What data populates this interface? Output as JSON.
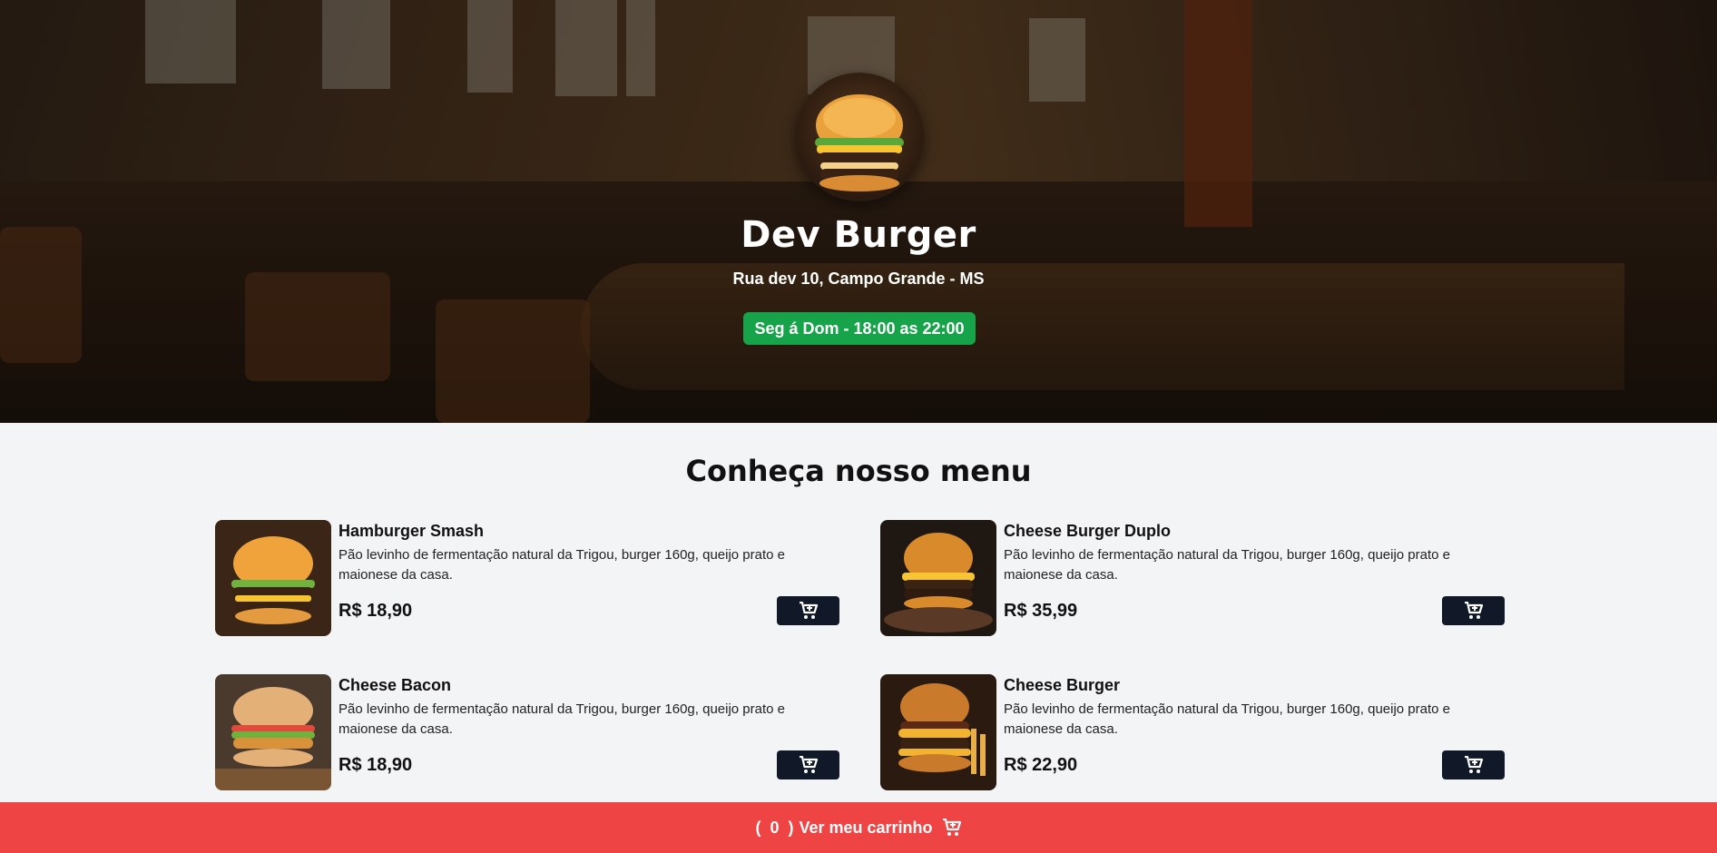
{
  "header": {
    "store_name": "Dev Burger",
    "address": "Rua dev 10, Campo Grande - MS",
    "hours": "Seg á Dom - 18:00 as 22:00",
    "hours_color": "#16a34a"
  },
  "menu": {
    "title": "Conheça nosso menu",
    "items": [
      {
        "name": "Hamburger Smash",
        "description": "Pão levinho de fermentação natural da Trigou, burger 160g, queijo prato e maionese da casa.",
        "price": "R$ 18,90",
        "icon": "cart-plus-icon"
      },
      {
        "name": "Cheese Burger Duplo",
        "description": "Pão levinho de fermentação natural da Trigou, burger 160g, queijo prato e maionese da casa.",
        "price": "R$ 35,99",
        "icon": "cart-plus-icon"
      },
      {
        "name": "Cheese Bacon",
        "description": "Pão levinho de fermentação natural da Trigou, burger 160g, queijo prato e maionese da casa.",
        "price": "R$ 18,90",
        "icon": "cart-plus-icon"
      },
      {
        "name": "Cheese Burger",
        "description": "Pão levinho de fermentação natural da Trigou, burger 160g, queijo prato e maionese da casa.",
        "price": "R$ 22,90",
        "icon": "cart-plus-icon"
      }
    ]
  },
  "cart": {
    "open_paren": "(",
    "count": "0",
    "close_paren": ")",
    "label": "Ver meu carrinho",
    "icon": "cart-plus-icon",
    "color": "#ef4444"
  }
}
